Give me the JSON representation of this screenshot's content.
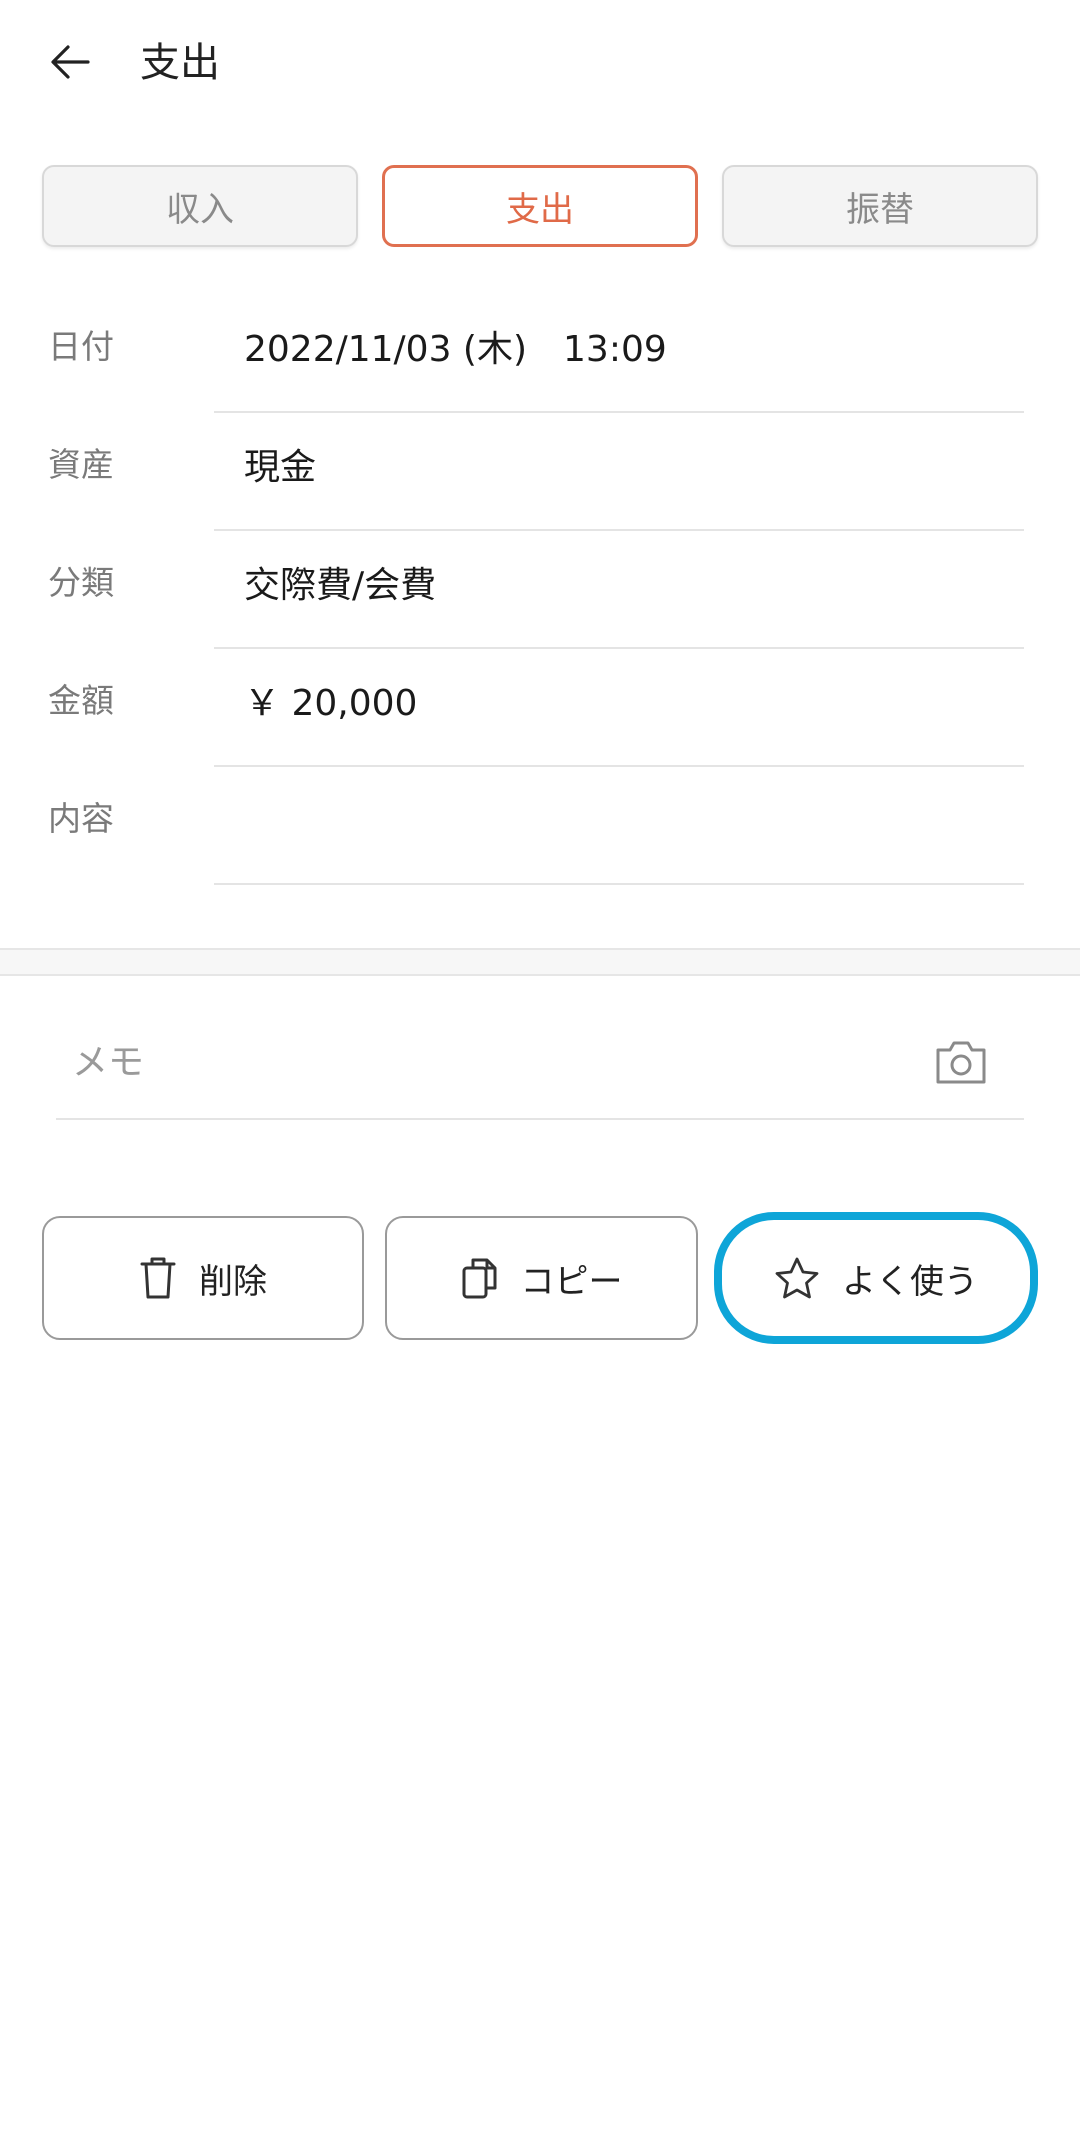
{
  "header": {
    "title": "支出",
    "back_icon": "arrow-left-icon"
  },
  "tabs": [
    {
      "label": "収入",
      "active": false
    },
    {
      "label": "支出",
      "active": true
    },
    {
      "label": "振替",
      "active": false
    }
  ],
  "form": {
    "rows": [
      {
        "label": "日付",
        "value": "2022/11/03 (木)　13:09"
      },
      {
        "label": "資産",
        "value": "現金"
      },
      {
        "label": "分類",
        "value": "交際費/会費"
      },
      {
        "label": "金額",
        "value": "￥ 20,000"
      },
      {
        "label": "内容",
        "value": ""
      }
    ]
  },
  "memo": {
    "placeholder": "メモ",
    "camera_icon": "camera-icon"
  },
  "actions": {
    "delete_label": "削除",
    "copy_label": "コピー",
    "favorite_label": "よく使う"
  },
  "colors": {
    "accent": "#e06a48",
    "highlight": "#0ea5d8",
    "label_gray": "#7a7a7a"
  }
}
